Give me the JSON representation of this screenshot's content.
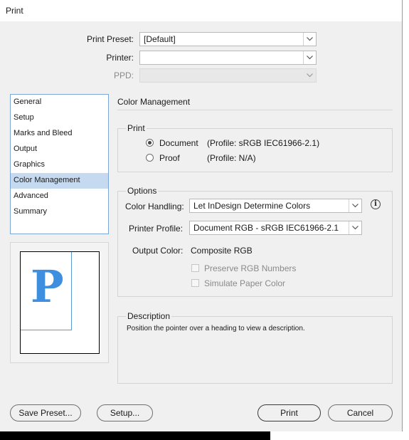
{
  "window": {
    "title": "Print"
  },
  "header": {
    "print_preset_label": "Print Preset:",
    "print_preset_value": "[Default]",
    "printer_label": "Printer:",
    "printer_value": "",
    "ppd_label": "PPD:",
    "ppd_value": ""
  },
  "sidebar": {
    "items": [
      {
        "label": "General"
      },
      {
        "label": "Setup"
      },
      {
        "label": "Marks and Bleed"
      },
      {
        "label": "Output"
      },
      {
        "label": "Graphics"
      },
      {
        "label": "Color Management"
      },
      {
        "label": "Advanced"
      },
      {
        "label": "Summary"
      }
    ],
    "selected": "Color Management"
  },
  "preview": {
    "glyph": "P",
    "accent": "#3e8fe0"
  },
  "main": {
    "section_title": "Color Management",
    "print_group": {
      "label": "Print",
      "document_label": "Document",
      "document_profile": "(Profile: sRGB IEC61966-2.1)",
      "proof_label": "Proof",
      "proof_profile": "(Profile: N/A)",
      "selected": "Document"
    },
    "options_group": {
      "label": "Options",
      "color_handling_label": "Color Handling:",
      "color_handling_value": "Let InDesign Determine Colors",
      "printer_profile_label": "Printer Profile:",
      "printer_profile_value": "Document RGB - sRGB IEC61966-2.1",
      "output_color_label": "Output Color:",
      "output_color_value": "Composite RGB",
      "preserve_rgb_label": "Preserve RGB Numbers",
      "simulate_paper_label": "Simulate Paper Color"
    },
    "description_group": {
      "label": "Description",
      "text": "Position the pointer over a heading to view a description."
    }
  },
  "footer": {
    "save_preset_label": "Save Preset...",
    "setup_label": "Setup...",
    "print_label": "Print",
    "cancel_label": "Cancel"
  }
}
